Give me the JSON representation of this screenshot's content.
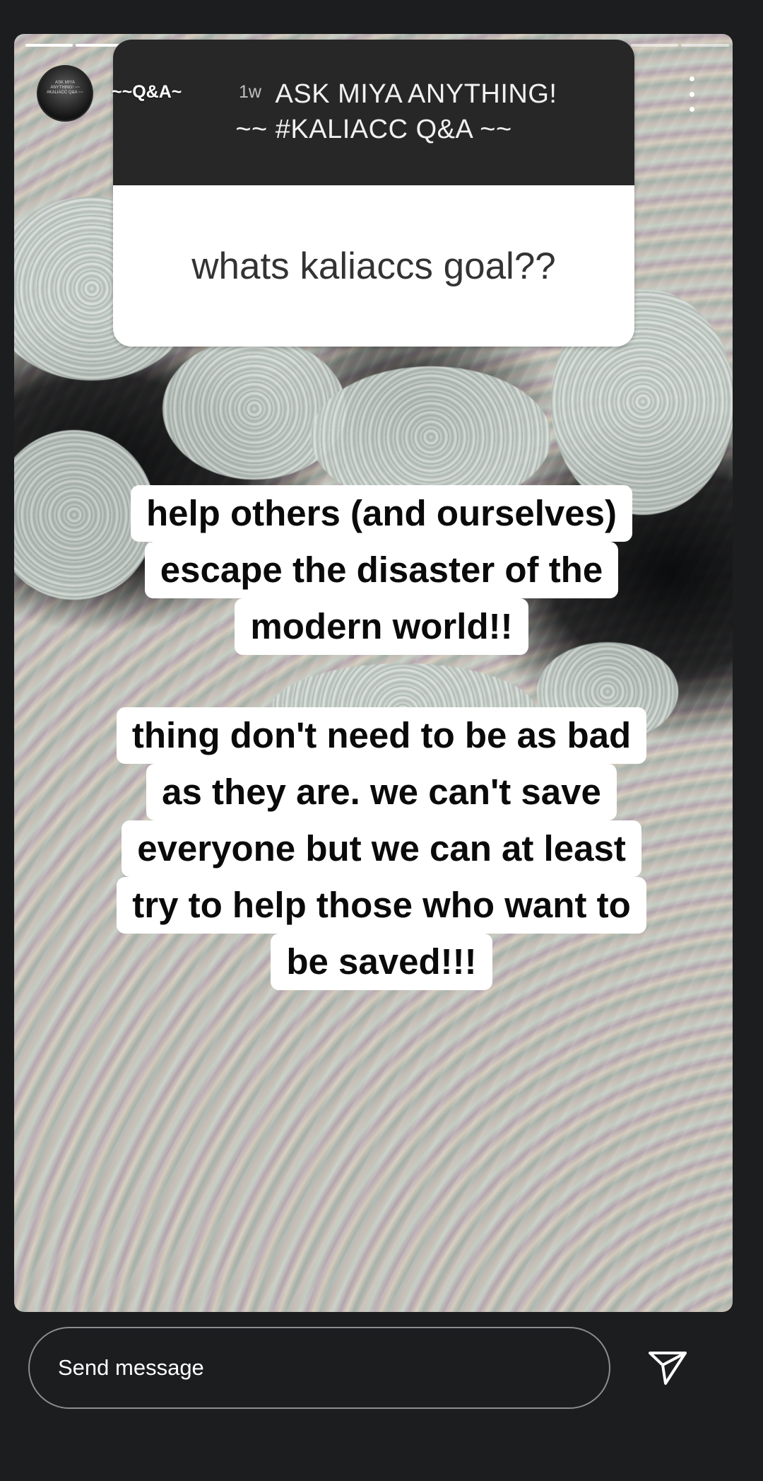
{
  "story": {
    "progress": {
      "segments": 14,
      "current": 2
    },
    "header": {
      "username": "~~Q&A~",
      "timestamp": "1w"
    },
    "avatar_text": "ASK MIYA ANYTHING! ~~ #KALIACC Q&A ~~",
    "question_box": {
      "title_line1": "ASK MIYA ANYTHING!",
      "title_line2": "~~ #KALIACC Q&A ~~",
      "question": "whats kaliaccs goal??"
    },
    "caption1": [
      "help others (and ourselves)",
      "escape the disaster of the",
      "modern world!!"
    ],
    "caption2": [
      "thing don't need to be as bad",
      "as they are. we can't save",
      "everyone but we can at least",
      "try to help those who want to",
      "be saved!!!"
    ]
  },
  "reply": {
    "placeholder": "Send message"
  },
  "icons": {
    "more": "more-vertical-icon",
    "send": "send-icon"
  }
}
